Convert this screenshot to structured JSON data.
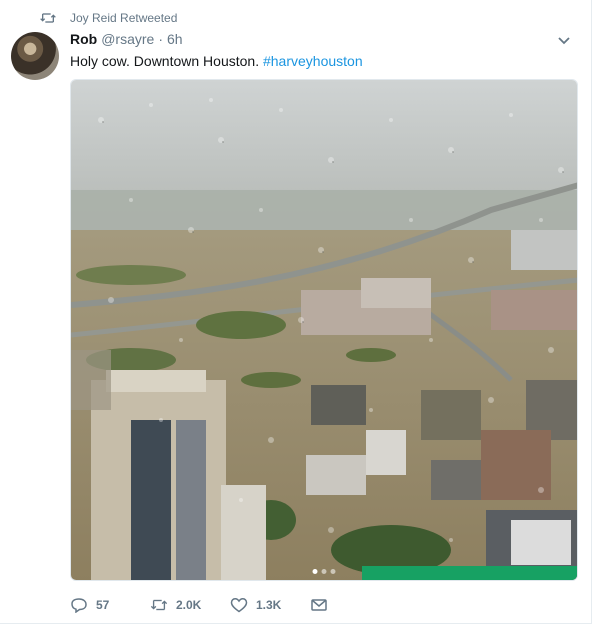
{
  "retweet_context": {
    "icon": "retweet-icon",
    "text": "Joy Reid Retweeted"
  },
  "tweet": {
    "author_name": "Rob",
    "author_handle": "@rsayre",
    "separator": "·",
    "timestamp": "6h",
    "text": "Holy cow. Downtown Houston.",
    "hashtag": "#harveyhouston"
  },
  "media": {
    "alt": "Aerial view of flooded downtown Houston seen through a rain-covered window",
    "carousel_pages": 3,
    "carousel_active": 1
  },
  "actions": {
    "reply_count": "57",
    "retweet_count": "2.0K",
    "like_count": "1.3K"
  },
  "colors": {
    "link": "#1b95e0",
    "secondary_text": "#657786",
    "primary_text": "#14171a"
  }
}
